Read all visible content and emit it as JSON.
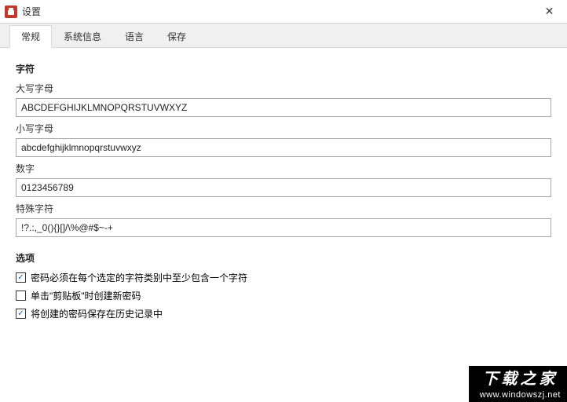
{
  "window": {
    "title": "设置"
  },
  "tabs": [
    {
      "label": "常规",
      "active": true
    },
    {
      "label": "系统信息",
      "active": false
    },
    {
      "label": "语言",
      "active": false
    },
    {
      "label": "保存",
      "active": false
    }
  ],
  "chars_section": {
    "title": "字符",
    "uppercase_label": "大写字母",
    "uppercase_value": "ABCDEFGHIJKLMNOPQRSTUVWXYZ",
    "lowercase_label": "小写字母",
    "lowercase_value": "abcdefghijklmnopqrstuvwxyz",
    "digits_label": "数字",
    "digits_value": "0123456789",
    "special_label": "特殊字符",
    "special_value": "!?.:,_0(){}[]/\\%@#$~-+"
  },
  "options_section": {
    "title": "选项",
    "opt1": {
      "checked": true,
      "label": "密码必须在每个选定的字符类别中至少包含一个字符"
    },
    "opt2": {
      "checked": false,
      "label": "单击\"剪贴板\"时创建新密码"
    },
    "opt3": {
      "checked": true,
      "label": "将创建的密码保存在历史记录中"
    }
  },
  "watermark": {
    "line1": "下载之家",
    "line2": "www.windowszj.net"
  }
}
